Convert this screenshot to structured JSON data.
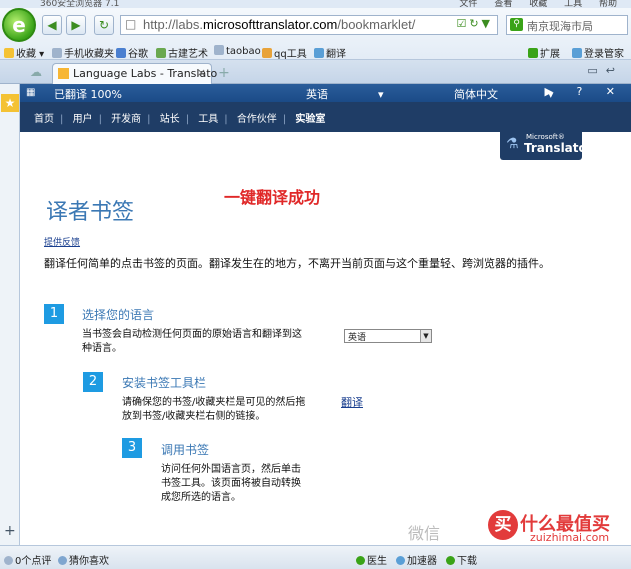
{
  "browser": {
    "title": "360安全浏览器 7.1",
    "menus": [
      "文件",
      "查看",
      "收藏",
      "工具",
      "帮助"
    ],
    "url_prefix": "http://labs.",
    "url_domain": "microsofttranslator.com",
    "url_suffix": "/bookmarklet/",
    "search_value": "南京现海市局",
    "favbar": {
      "favorites": "收藏",
      "items": [
        "手机收藏夹",
        "谷歌",
        "古建艺术",
        "taobao",
        "qq工具",
        "翻译"
      ],
      "extensions": "扩展",
      "login": "登录管家"
    },
    "tab_label": "Language Labs - Translato",
    "tab_close": "×",
    "new_tab": "+"
  },
  "translator_bar": {
    "status": "已翻译 100%",
    "from_lang": "英语",
    "to_lang": "简体中文",
    "controls": "▶ ? ✕"
  },
  "page": {
    "nav": [
      "首页",
      "用户",
      "开发商",
      "站长",
      "工具",
      "合作伙伴",
      "实验室"
    ],
    "brand_small": "Microsoft®",
    "brand": "Translator",
    "title": "译者书签",
    "annotation": "一键翻译成功",
    "feedback": "提供反馈",
    "intro": "翻译任何简单的点击书签的页面。翻译发生在的地方，不离开当前页面与这个重量轻、跨浏览器的插件。",
    "steps": [
      {
        "num": "1",
        "title": "选择您的语言",
        "desc": "当书签会自动检测任何页面的原始语言和翻译到这种语言。"
      },
      {
        "num": "2",
        "title": "安装书签工具栏",
        "desc": "请确保您的书签/收藏夹栏是可见的然后拖放到书签/收藏夹栏右侧的链接。"
      },
      {
        "num": "3",
        "title": "调用书签",
        "desc": "访问任何外国语言页，然后单击书签工具。该页面将被自动转换成您所选的语言。"
      }
    ],
    "lang_select": "英语",
    "translate_link": "翻译"
  },
  "watermark": {
    "weixin": "微信",
    "site": "什么最值买",
    "logo_char": "买",
    "url": "zuizhimai.com"
  },
  "status_bar": {
    "comments": "0个点评",
    "guess": "猜你喜欢",
    "doctor": "医生",
    "accelerator": "加速器",
    "download": "下载"
  },
  "colors": {
    "nav_bg": "#1f3d66",
    "translator_bar": "#2a5d9a",
    "step_badge": "#1e9be2",
    "heading": "#3b78b4",
    "annotation": "#e02828"
  }
}
